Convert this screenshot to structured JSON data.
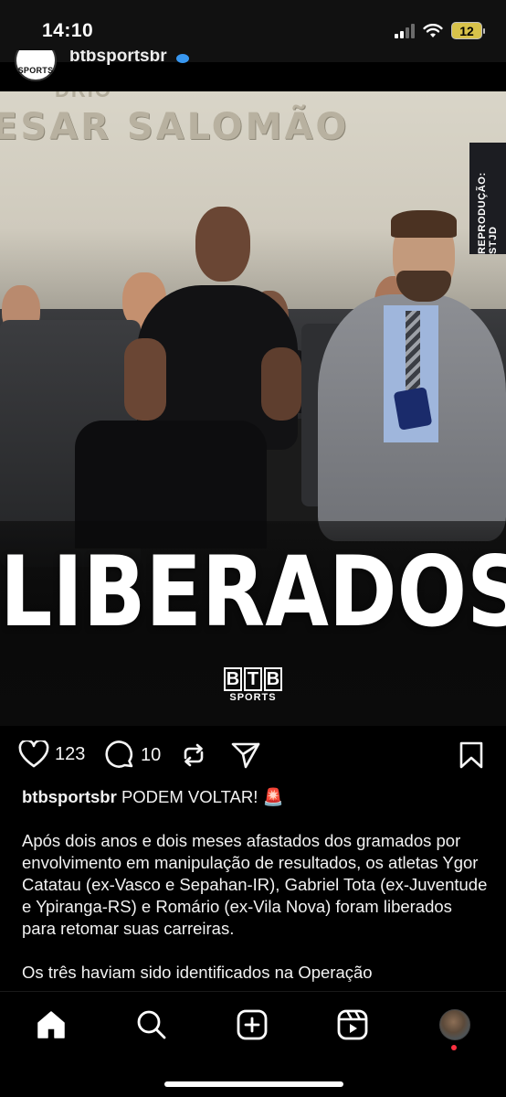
{
  "status_bar": {
    "time": "14:10",
    "battery": "12",
    "icons": [
      "signal-icon",
      "wifi-icon",
      "battery-icon"
    ]
  },
  "post": {
    "username": "btbsportsbr",
    "avatar_text": "SPORTS",
    "image": {
      "wall_text": "ESAR SALOMÃO",
      "wall_text_top": "DRIO",
      "repro_tag": "REPRODUÇÃO: STJD",
      "headline": "LIBERADOS!",
      "logo_letters": [
        "B",
        "T",
        "B"
      ],
      "logo_sub": "SPORTS"
    },
    "actions": {
      "likes": "123",
      "comments": "10"
    },
    "caption": {
      "username": "btbsportsbr",
      "title": "PODEM VOLTAR! 🚨",
      "paragraph1": "Após dois anos e dois meses afastados dos gramados por envolvimento em manipulação de resultados, os atletas Ygor Catatau (ex-Vasco e Sepahan-IR), Gabriel Tota (ex-Juventude e Ypiranga-RS) e Romário (ex-Vila Nova) foram liberados para retomar suas carreiras.",
      "paragraph2": "Os três haviam sido identificados na Operação"
    }
  },
  "bottom_nav": {
    "items": [
      "home-icon",
      "search-icon",
      "create-icon",
      "reels-icon",
      "profile-avatar"
    ]
  },
  "colors": {
    "background": "#000000",
    "text": "#f5f5f5",
    "verified": "#3897f0",
    "notification": "#ff3040",
    "battery": "#d8c24a"
  }
}
